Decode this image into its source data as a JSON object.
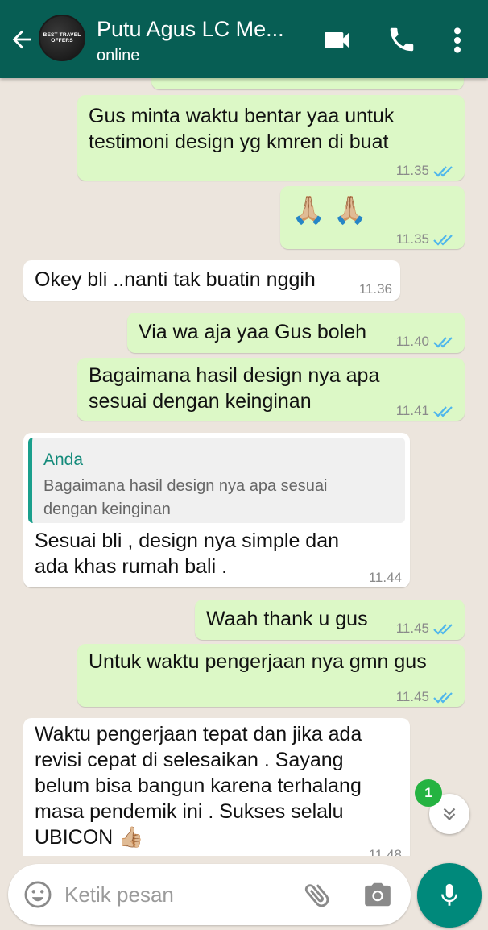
{
  "header": {
    "title": "Putu Agus LC Me...",
    "status": "online",
    "avatar_text": [
      "BEST TRAVEL",
      "OFFERS"
    ],
    "icons": [
      "back-arrow-icon",
      "video-call-icon",
      "phone-icon",
      "more-vert-icon"
    ]
  },
  "messages": [
    {
      "id": "m1",
      "direction": "out",
      "text": "Gus minta waktu bentar yaa untuk\ntestimoni design yg kmren di buat",
      "time": "11.35",
      "ticks": "read"
    },
    {
      "id": "m2",
      "direction": "out",
      "text": "🙏🏼 🙏🏼",
      "time": "11.35",
      "ticks": "read"
    },
    {
      "id": "m3",
      "direction": "in",
      "text": "Okey bli ..nanti tak buatin nggih",
      "time": "11.36"
    },
    {
      "id": "m4",
      "direction": "out",
      "text": "Via wa aja yaa Gus boleh",
      "time": "11.40",
      "ticks": "read"
    },
    {
      "id": "m5",
      "direction": "out",
      "text": "Bagaimana hasil design nya apa\nsesuai dengan keinginan",
      "time": "11.41",
      "ticks": "read"
    },
    {
      "id": "m6",
      "direction": "in",
      "quote": {
        "name": "Anda",
        "text": "Bagaimana hasil design nya apa sesuai\ndengan keinginan"
      },
      "text": "Sesuai bli , design nya simple dan\nada khas rumah bali .",
      "time": "11.44"
    },
    {
      "id": "m7",
      "direction": "out",
      "text": "Waah thank u gus",
      "time": "11.45",
      "ticks": "read"
    },
    {
      "id": "m8",
      "direction": "out",
      "text": "Untuk waktu pengerjaan nya gmn gus",
      "time": "11.45",
      "ticks": "read"
    },
    {
      "id": "m9",
      "direction": "in",
      "text": "Waktu pengerjaan tepat dan jika ada\nrevisi cepat di selesaikan . Sayang\nbelum bisa bangun karena terhalang\nmasa pendemik ini . Sukses selalu\nUBICON 👍🏼",
      "time": "11.48"
    }
  ],
  "scroll_button": {
    "unread_count": "1",
    "icon": "double-chevron-down-icon"
  },
  "composer": {
    "placeholder": "Ketik pesan",
    "icons": [
      "emoji-icon",
      "attach-icon",
      "camera-icon",
      "mic-icon"
    ]
  },
  "colors": {
    "header": "#075e54",
    "outgoing_bubble": "#dcf8c6",
    "incoming_bubble": "#ffffff",
    "read_ticks": "#4fb6ec",
    "mic_button": "#00897b",
    "badge": "#25b341"
  }
}
